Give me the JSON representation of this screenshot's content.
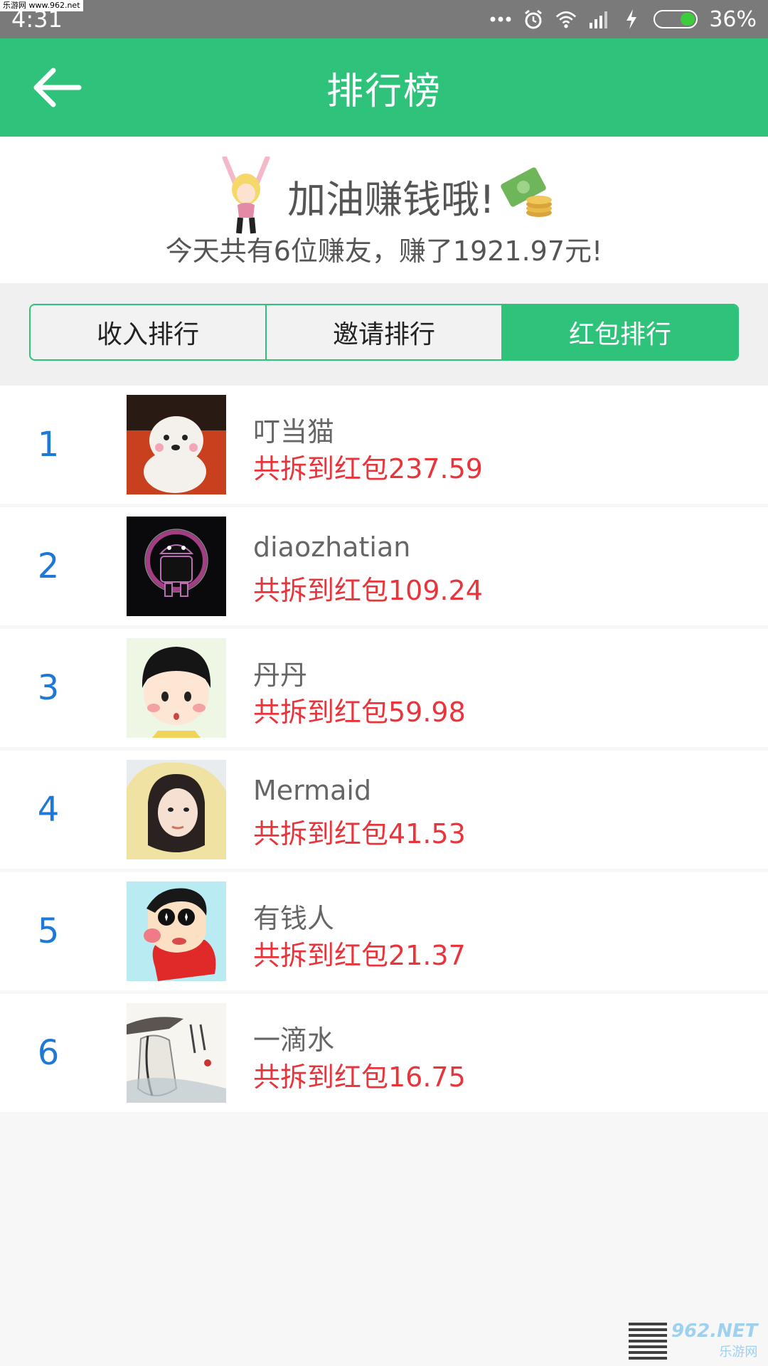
{
  "status_bar": {
    "time": "4:31",
    "watermark": "乐游网 www.962.net",
    "battery": "36%"
  },
  "app_bar": {
    "title": "排行榜",
    "back_icon": "arrow-left-icon"
  },
  "banner": {
    "headline": "加油赚钱哦!",
    "summary": "今天共有6位赚友，赚了1921.97元!"
  },
  "tabs": [
    {
      "label": "收入排行",
      "active": false
    },
    {
      "label": "邀请排行",
      "active": false
    },
    {
      "label": "红包排行",
      "active": true
    }
  ],
  "ranking": [
    {
      "rank": "1",
      "name": "叮当猫",
      "amount": "共拆到红包237.59"
    },
    {
      "rank": "2",
      "name": "diaozhatian",
      "amount": "共拆到红包109.24"
    },
    {
      "rank": "3",
      "name": "丹丹",
      "amount": "共拆到红包59.98"
    },
    {
      "rank": "4",
      "name": "Mermaid",
      "amount": "共拆到红包41.53"
    },
    {
      "rank": "5",
      "name": "有钱人",
      "amount": "共拆到红包21.37"
    },
    {
      "rank": "6",
      "name": "一滴水",
      "amount": "共拆到红包16.75"
    }
  ],
  "footer_watermark": {
    "text": "962.NET",
    "sub": "乐游网"
  },
  "colors": {
    "primary": "#2ec27a",
    "rank": "#1d78d6",
    "amount": "#e8343a"
  }
}
